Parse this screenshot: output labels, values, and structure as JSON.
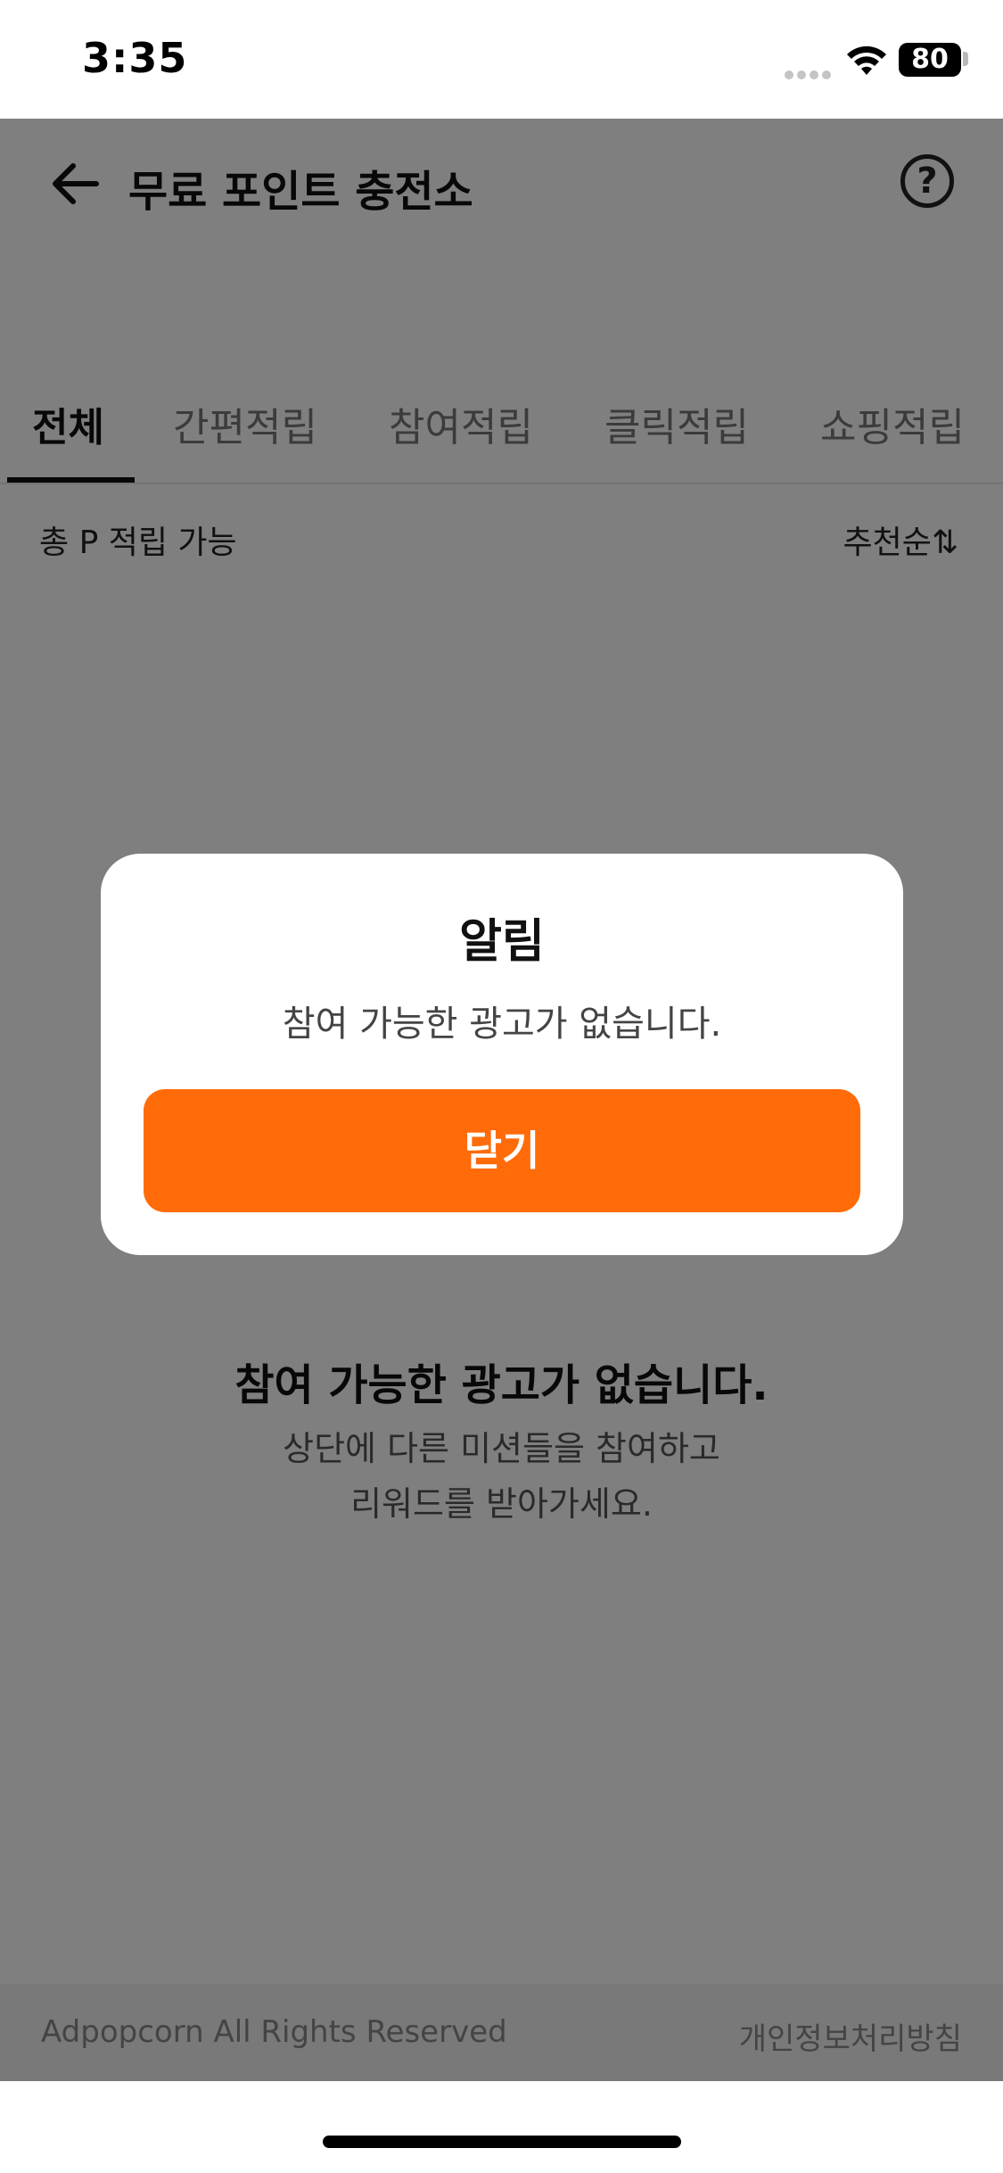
{
  "status_bar": {
    "time": "3:35",
    "battery_level": "80",
    "icons": [
      "signal-dots-icon",
      "wifi-icon",
      "battery-icon"
    ]
  },
  "header": {
    "title": "무료 포인트 충전소",
    "back_icon": "arrow-left-icon",
    "help_icon": "question-circle-icon",
    "help_glyph": "?"
  },
  "tabs": [
    {
      "label": "전체",
      "active": true
    },
    {
      "label": "간편적립",
      "active": false
    },
    {
      "label": "참여적립",
      "active": false
    },
    {
      "label": "클릭적립",
      "active": false
    },
    {
      "label": "쇼핑적립",
      "active": false
    }
  ],
  "summary": {
    "total_label": "총 P 적립 가능",
    "sort_label": "추천순",
    "sort_icon": "sort-arrows-icon",
    "sort_glyph": "⇅"
  },
  "empty_state": {
    "title": "참여 가능한 광고가 없습니다.",
    "desc_line1": "상단에 다른 미션들을 참여하고",
    "desc_line2": "리워드를 받아가세요."
  },
  "footer": {
    "copyright": "Adpopcorn All Rights Reserved",
    "privacy_link": "개인정보처리방침"
  },
  "dialog": {
    "title": "알림",
    "message": "참여 가능한 광고가 없습니다.",
    "close_label": "닫기"
  },
  "colors": {
    "accent": "#ff6b08",
    "overlay": "#000000"
  }
}
